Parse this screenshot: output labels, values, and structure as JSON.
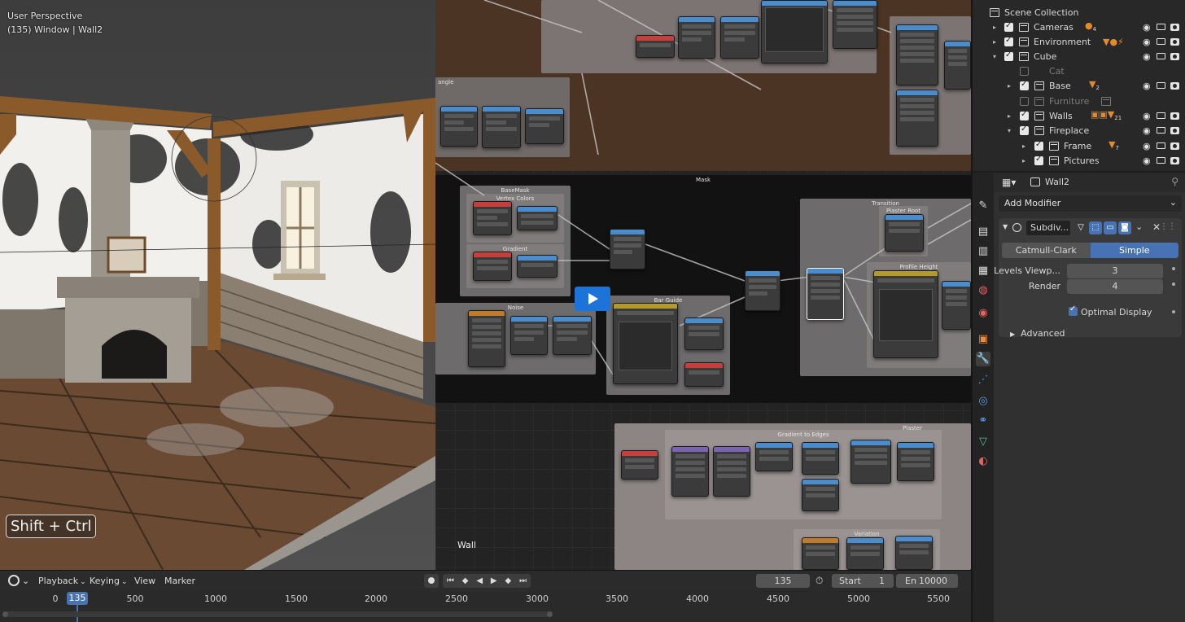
{
  "viewport": {
    "title": "User Perspective",
    "subtitle": "(135) Window | Wall2",
    "shortcut_hint": "Shift + Ctrl"
  },
  "node_editor": {
    "frames": [
      "Mask",
      "BaseMask",
      "Vertex Colors",
      "Gradient",
      "Noise",
      "Bar Guide",
      "Transition",
      "Plaster Root Mask",
      "Profile Height",
      "Gradient to Edges",
      "Plaster",
      "Variation",
      "angle"
    ],
    "frame_wall_label": "Wall"
  },
  "outliner": {
    "items": [
      {
        "name": "Scene Collection",
        "indent": 0,
        "checkbox": "none",
        "twisty": "",
        "badge": ""
      },
      {
        "name": "Cameras",
        "indent": 1,
        "checkbox": "on",
        "twisty": "▸",
        "badge": "4"
      },
      {
        "name": "Environment",
        "indent": 1,
        "checkbox": "on",
        "twisty": "▸",
        "badge": ""
      },
      {
        "name": "Cube",
        "indent": 1,
        "checkbox": "on",
        "twisty": "▾",
        "badge": ""
      },
      {
        "name": "Cat",
        "indent": 2,
        "checkbox": "off",
        "twisty": "",
        "badge": ""
      },
      {
        "name": "Base",
        "indent": 2,
        "checkbox": "on",
        "twisty": "▸",
        "badge": "2"
      },
      {
        "name": "Furniture",
        "indent": 2,
        "checkbox": "off",
        "twisty": "",
        "badge": ""
      },
      {
        "name": "Walls",
        "indent": 2,
        "checkbox": "on",
        "twisty": "▸",
        "badge": "21"
      },
      {
        "name": "Fireplace",
        "indent": 2,
        "checkbox": "on",
        "twisty": "▾",
        "badge": ""
      },
      {
        "name": "Frame",
        "indent": 3,
        "checkbox": "on",
        "twisty": "▸",
        "badge": "7"
      },
      {
        "name": "Pictures",
        "indent": 3,
        "checkbox": "on",
        "twisty": "▸",
        "badge": ""
      }
    ]
  },
  "properties": {
    "object_name": "Wall2",
    "add_modifier": "Add Modifier",
    "modifier": {
      "name": "Subdiv...",
      "mode_options": [
        "Catmull-Clark",
        "Simple"
      ],
      "mode_selected": "Simple",
      "levels_viewport_label": "Levels Viewp...",
      "levels_viewport": "3",
      "render_label": "Render",
      "render": "4",
      "optimal_display_label": "Optimal Display",
      "optimal_display": true,
      "advanced_label": "Advanced"
    }
  },
  "timeline": {
    "menus": [
      "Playback",
      "Keying",
      "View",
      "Marker"
    ],
    "current_frame": "135",
    "start_label": "Start",
    "start": "1",
    "end_label": "En",
    "end": "10000",
    "ruler_ticks": [
      "0",
      "500",
      "1000",
      "1500",
      "2000",
      "2500",
      "3000",
      "3500",
      "4000",
      "4500",
      "5000",
      "5500"
    ],
    "playhead": "135"
  },
  "colors": {
    "accent": "#4772b3",
    "orange_badge": "#e58a2c",
    "play_button": "#1e73d8"
  }
}
